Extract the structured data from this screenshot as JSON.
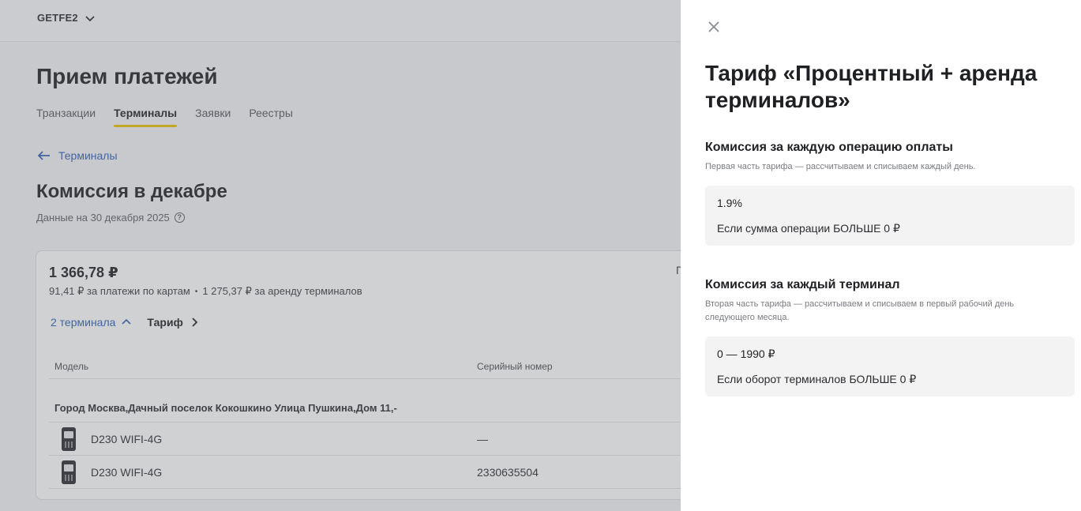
{
  "header": {
    "org_name": "GETFE2"
  },
  "page": {
    "title": "Прием платежей",
    "tabs": [
      {
        "label": "Транзакции",
        "active": false
      },
      {
        "label": "Терминалы",
        "active": true
      },
      {
        "label": "Заявки",
        "active": false
      },
      {
        "label": "Реестры",
        "active": false
      }
    ],
    "back_link": "Терминалы",
    "section_title": "Комиссия в декабре",
    "date_note": "Данные на 30 декабря 2025",
    "info_icon_glyph": "?"
  },
  "card": {
    "total": "1 366,78 ₽",
    "cards_part": "91,41 ₽ за платежи по картам",
    "separator": "•",
    "rent_part": "1 275,37 ₽ за аренду терминалов",
    "terminals_link": "2 терминала",
    "tariff_link": "Тариф",
    "truncated_text": "Г",
    "columns": {
      "model": "Модель",
      "serial": "Серийный номер"
    },
    "address": "Город Москва,Дачный поселок Кокошкино Улица Пушкина,Дом 11,-",
    "rows": [
      {
        "model": "D230 WIFI-4G",
        "serial": "—"
      },
      {
        "model": "D230 WIFI-4G",
        "serial": "2330635504"
      }
    ]
  },
  "panel": {
    "title": "Тариф «Процентный + аренда терминалов»",
    "blocks": [
      {
        "title": "Комиссия за каждую операцию оплаты",
        "subtitle": "Первая часть тарифа — рассчитываем и списываем каждый день.",
        "value": "1.9%",
        "condition": "Если сумма операции БОЛЬШЕ 0 ₽"
      },
      {
        "title": "Комиссия за каждый терминал",
        "subtitle": "Вторая часть тарифа — рассчитываем и списываем в первый рабочий день следующего месяца.",
        "value": "0 — 1990 ₽",
        "condition": "Если оборот терминалов БОЛЬШЕ 0 ₽"
      }
    ]
  },
  "colors": {
    "accent_tab": "#e8c100",
    "link": "#2f5fb3"
  }
}
